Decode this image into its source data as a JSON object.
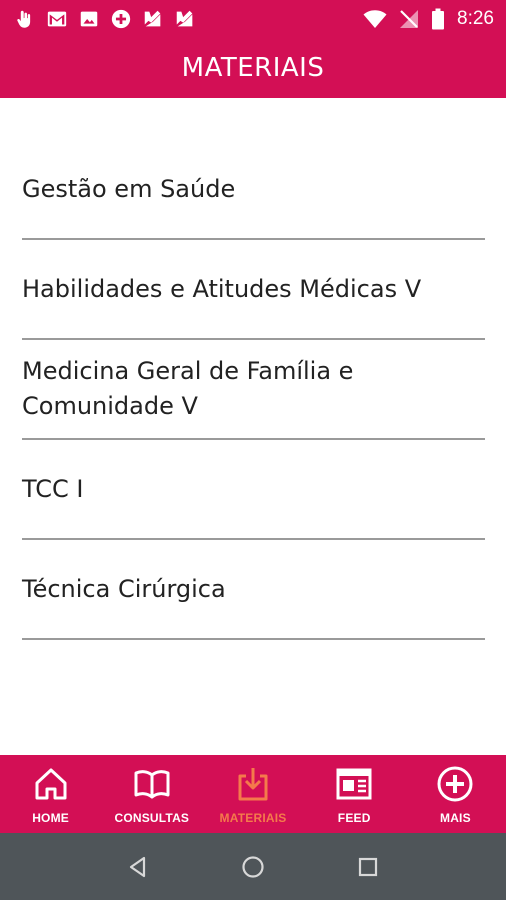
{
  "status_bar": {
    "time": "8:26",
    "icons_left": [
      "touch-icon",
      "gmail-icon",
      "image-icon",
      "plus-circle-icon",
      "check-badge-icon",
      "check-badge-icon"
    ],
    "icons_right": [
      "wifi-icon",
      "no-signal-icon",
      "battery-icon"
    ]
  },
  "header": {
    "title": "MATERIAIS"
  },
  "materials": {
    "items": [
      {
        "label": "Gestão em Saúde"
      },
      {
        "label": "Habilidades e Atitudes Médicas V"
      },
      {
        "label": "Medicina Geral de Família e Comunidade V"
      },
      {
        "label": "TCC I"
      },
      {
        "label": "Técnica Cirúrgica"
      }
    ]
  },
  "bottom_nav": {
    "items": [
      {
        "label": "HOME",
        "icon": "home-icon",
        "active": false
      },
      {
        "label": "CONSULTAS",
        "icon": "book-icon",
        "active": false
      },
      {
        "label": "MATERIAIS",
        "icon": "download-icon",
        "active": true
      },
      {
        "label": "FEED",
        "icon": "newspaper-icon",
        "active": false
      },
      {
        "label": "MAIS",
        "icon": "plus-circle-icon",
        "active": false
      }
    ]
  },
  "system_nav": {
    "buttons": [
      "back-icon",
      "home-circle-icon",
      "recents-icon"
    ]
  },
  "colors": {
    "brand": "#d30f55",
    "active_tab": "#f47a4b",
    "system_bar": "#4f5559",
    "divider": "#9a9a9a"
  }
}
